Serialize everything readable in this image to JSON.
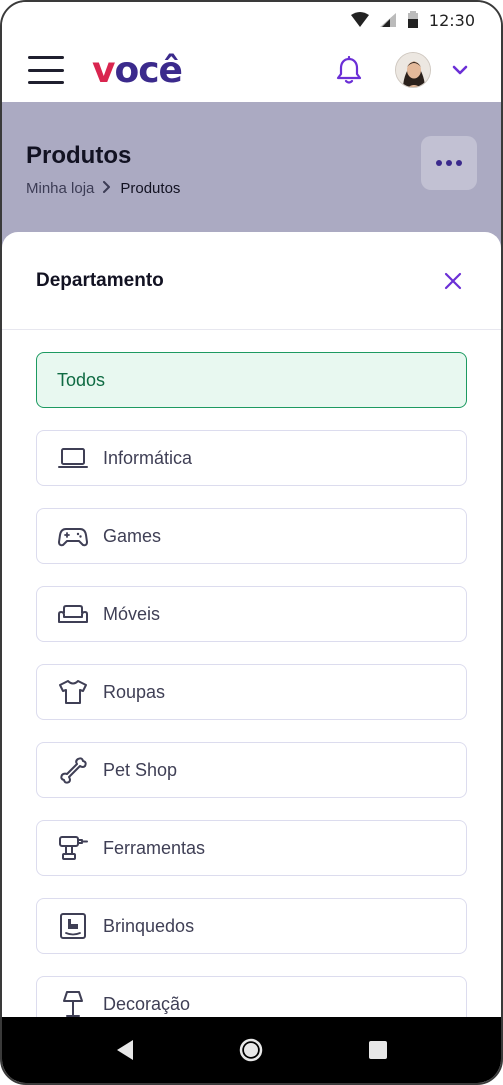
{
  "status_bar": {
    "time": "12:30"
  },
  "header": {
    "logo_first": "v",
    "logo_rest": "ocê",
    "accent_color": "#6b2fd6",
    "logo_color": "#3b2a8c",
    "logo_v_color": "#d9254f"
  },
  "page": {
    "title": "Produtos",
    "breadcrumb": [
      "Minha loja",
      "Produtos"
    ]
  },
  "sheet": {
    "title": "Departamento",
    "options": [
      {
        "label": "Todos",
        "icon": "none",
        "selected": true
      },
      {
        "label": "Informática",
        "icon": "laptop-icon"
      },
      {
        "label": "Games",
        "icon": "gamepad-icon"
      },
      {
        "label": "Móveis",
        "icon": "sofa-icon"
      },
      {
        "label": "Roupas",
        "icon": "shirt-icon"
      },
      {
        "label": "Pet Shop",
        "icon": "bone-icon"
      },
      {
        "label": "Ferramentas",
        "icon": "drill-icon"
      },
      {
        "label": "Brinquedos",
        "icon": "rocking-horse-icon"
      },
      {
        "label": "Decoração",
        "icon": "lamp-icon"
      }
    ]
  }
}
